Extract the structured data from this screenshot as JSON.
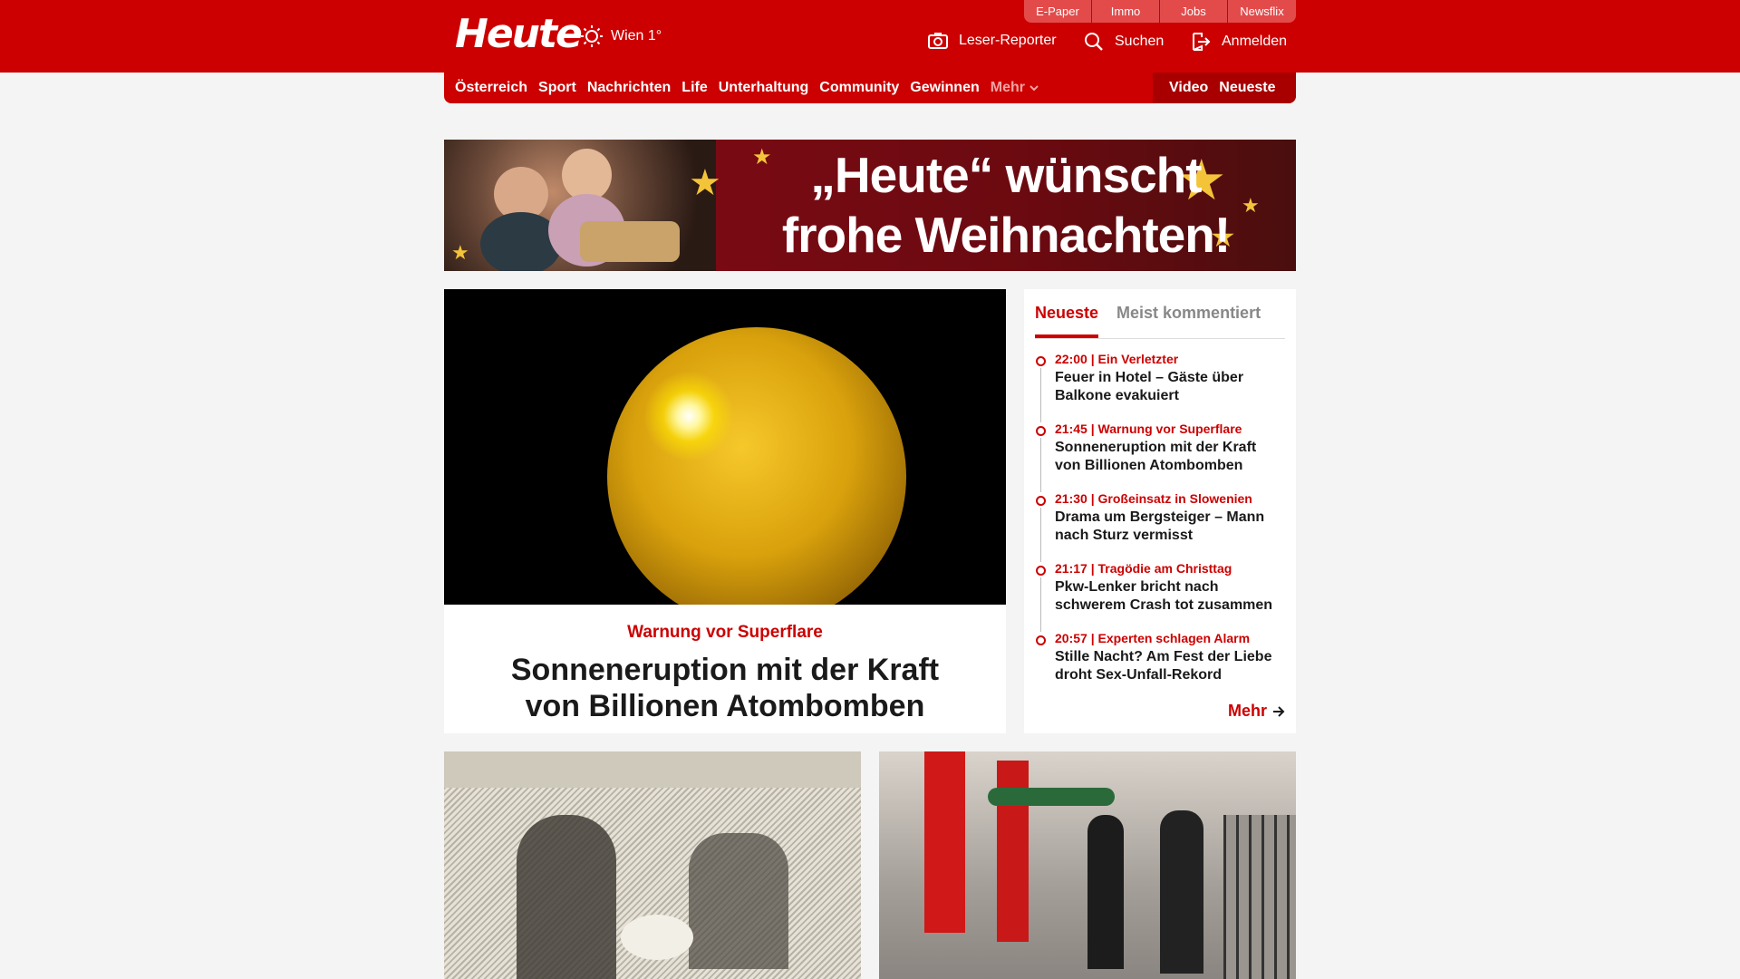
{
  "header": {
    "logo": "Heute",
    "weather": "Wien 1°",
    "top_tabs": [
      "E-Paper",
      "Immo",
      "Jobs",
      "Newsflix"
    ],
    "leser_reporter": "Leser-Reporter",
    "search": "Suchen",
    "login": "Anmelden"
  },
  "nav": {
    "items": [
      "Österreich",
      "Sport",
      "Nachrichten",
      "Life",
      "Unterhaltung",
      "Community",
      "Gewinnen"
    ],
    "more": "Mehr",
    "video": "Video",
    "latest": "Neueste"
  },
  "banner": {
    "line1": "„Heute“ wünscht",
    "line2": "frohe Weihnachten!"
  },
  "hero": {
    "kicker": "Warnung vor Superflare",
    "title": "Sonneneruption mit der Kraft von Billionen Atombomben"
  },
  "sidebar": {
    "tabs": [
      "Neueste",
      "Meist kommentiert"
    ],
    "entries": [
      {
        "meta": "22:00 | Ein Verletzter",
        "title": "Feuer in Hotel – Gäste über Balkone evakuiert"
      },
      {
        "meta": "21:45 | Warnung vor Superflare",
        "title": "Sonneneruption mit der Kraft von Billionen Atombomben"
      },
      {
        "meta": "21:30 | Großeinsatz in Slowenien",
        "title": "Drama um Bergsteiger – Mann nach Sturz vermisst"
      },
      {
        "meta": "21:17 | Tragödie am Christtag",
        "title": "Pkw-Lenker bricht nach schwerem Crash tot zusammen"
      },
      {
        "meta": "20:57 | Experten schlagen Alarm",
        "title": "Stille Nacht? Am Fest der Liebe droht Sex-Unfall-Rekord"
      }
    ],
    "more": "Mehr"
  },
  "colors": {
    "brand_red": "#cc0000",
    "dark_red": "#a80000",
    "background": "#f4f4f4"
  }
}
